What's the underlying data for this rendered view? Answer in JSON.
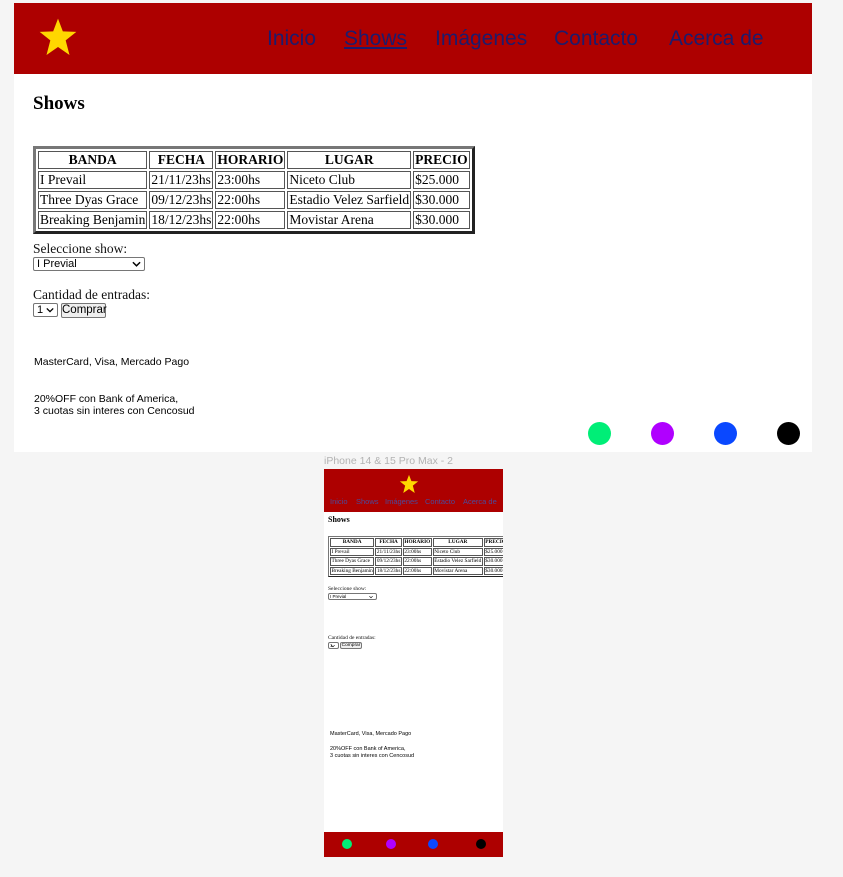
{
  "frame_label": "iPhone 14 & 15 Pro Max - 2",
  "nav": {
    "items": [
      {
        "label": "Inicio",
        "active": false
      },
      {
        "label": "Shows",
        "active": true
      },
      {
        "label": "Imágenes",
        "active": false
      },
      {
        "label": "Contacto",
        "active": false
      },
      {
        "label": "Acerca de",
        "active": false
      }
    ]
  },
  "page": {
    "title": "Shows"
  },
  "table": {
    "headers": [
      "BANDA",
      "FECHA",
      "HORARIO",
      "LUGAR",
      "PRECIO"
    ],
    "rows": [
      [
        "I Prevail",
        "21/11/23hs",
        "23:00hs",
        "Niceto Club",
        "$25.000"
      ],
      [
        "Three Dyas Grace",
        "09/12/23hs",
        "22:00hs",
        "Estadio Velez Sarfield",
        "$30.000"
      ],
      [
        "Breaking Benjamin",
        "18/12/23hs",
        "22:00hs",
        "Movistar Arena",
        "$30.000"
      ]
    ]
  },
  "form": {
    "show_label": "Seleccione show:",
    "show_selected": "I Previal",
    "quantity_label": "Cantidad de entradas:",
    "quantity_selected": "1",
    "buy_button": "Comprar"
  },
  "info": {
    "payments": "MasterCard, Visa, Mercado Pago",
    "promo_line1": "20%OFF con Bank of America,",
    "promo_line2": "3 cuotas sin interes con Cencosud"
  },
  "colors": {
    "header_red": "#ad0000",
    "star_yellow": "#ffd700",
    "dot_green": "#00ee77",
    "dot_purple": "#b000ff",
    "dot_blue": "#0a48ff",
    "dot_black": "#000000"
  },
  "icons": {
    "logo": "star-icon",
    "caret": "chevron-down-icon"
  }
}
